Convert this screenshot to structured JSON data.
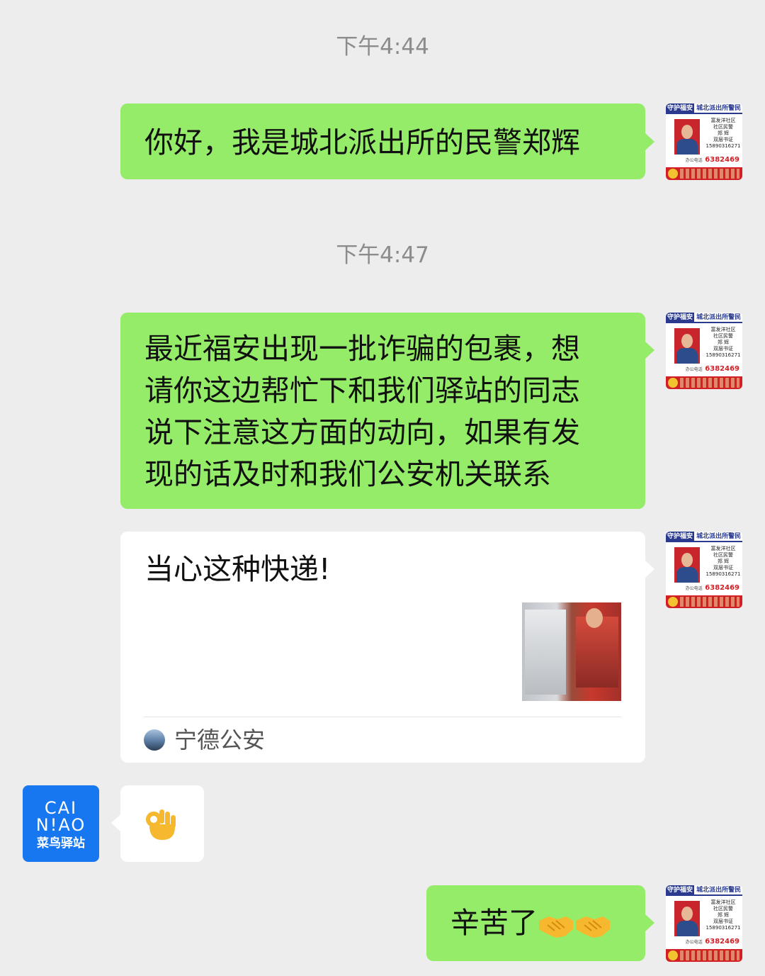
{
  "timestamps": [
    "下午4:44",
    "下午4:47"
  ],
  "police_avatar": {
    "top_left": "守护福安",
    "top_right": "城北派出所警民",
    "info_lines": [
      "富发洋社区",
      "社区民警",
      "郑 辉",
      "双层书证",
      "15890316271"
    ],
    "phone_label": "办公电话",
    "phone": "6382469"
  },
  "cainiao_avatar": {
    "line1": "CAI",
    "line2": "N!AO",
    "line3": "菜鸟驿站"
  },
  "messages": {
    "m1": "你好，我是城北派出所的民警郑辉",
    "m2_lines": [
      "最近福安出现一批诈骗的包裹，想",
      "请你这边帮忙下和我们驿站的同志",
      "说下注意这方面的动向，如果有发",
      "现的话及时和我们公安机关联系"
    ],
    "card": {
      "title": "当心这种快递!",
      "source": "宁德公安"
    },
    "reply_emoji_name": "ok-hand-icon",
    "m5": "辛苦了"
  },
  "colors": {
    "background": "#ededed",
    "sent_bubble": "#95ec69",
    "received_bubble": "#ffffff",
    "cainiao_blue": "#1677f0"
  }
}
